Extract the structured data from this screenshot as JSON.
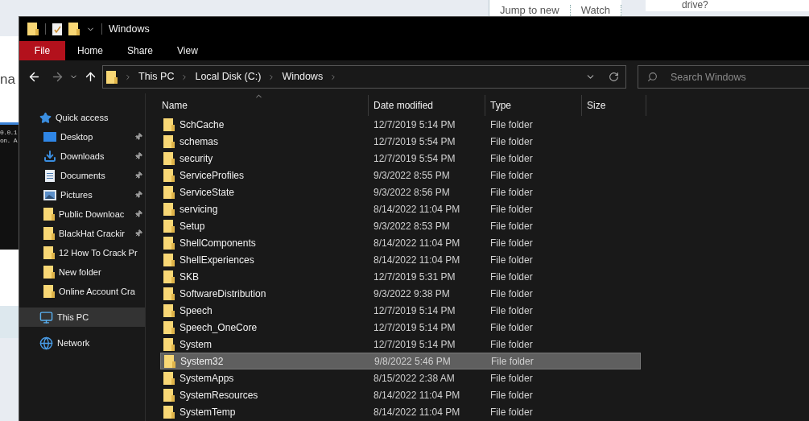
{
  "background": {
    "left_text": "na",
    "terminal_lines": [
      "0.0.1",
      "on. A"
    ],
    "top_links": [
      "Jump to new",
      "Watch"
    ],
    "top_right_text": "drive?"
  },
  "window": {
    "title": "Windows"
  },
  "ribbon_tabs": [
    {
      "label": "File",
      "kind": "file_menu"
    },
    {
      "label": "Home",
      "kind": "tab"
    },
    {
      "label": "Share",
      "kind": "tab"
    },
    {
      "label": "View",
      "kind": "tab"
    }
  ],
  "address": {
    "breadcrumbs": [
      "This PC",
      "Local Disk (C:)",
      "Windows"
    ]
  },
  "search": {
    "placeholder": "Search Windows"
  },
  "sidebar": {
    "items": [
      {
        "label": "Quick access",
        "kind": "quick_access",
        "selected": false,
        "children": [
          {
            "label": "Desktop",
            "kind": "desktop",
            "pinned": true
          },
          {
            "label": "Downloads",
            "kind": "downloads",
            "pinned": true
          },
          {
            "label": "Documents",
            "kind": "documents",
            "pinned": true
          },
          {
            "label": "Pictures",
            "kind": "pictures",
            "pinned": true
          },
          {
            "label": "Public Downloac",
            "kind": "folder",
            "pinned": true
          },
          {
            "label": "BlackHat Crackir",
            "kind": "folder",
            "pinned": true
          },
          {
            "label": "12 How To Crack Pr",
            "kind": "folder",
            "pinned": false
          },
          {
            "label": "New folder",
            "kind": "folder",
            "pinned": false
          },
          {
            "label": "Online Account Cra",
            "kind": "folder",
            "pinned": false
          }
        ]
      },
      {
        "label": "This PC",
        "kind": "pc",
        "selected": true
      },
      {
        "label": "Network",
        "kind": "network",
        "selected": false
      }
    ]
  },
  "table": {
    "columns": [
      {
        "label": "Name",
        "sorted": true
      },
      {
        "label": "Date modified",
        "sorted": false
      },
      {
        "label": "Type",
        "sorted": false
      },
      {
        "label": "Size",
        "sorted": false
      }
    ],
    "rows": [
      {
        "name": "SchCache",
        "date": "12/7/2019 5:14 PM",
        "type": "File folder",
        "selected": false
      },
      {
        "name": "schemas",
        "date": "12/7/2019 5:54 PM",
        "type": "File folder",
        "selected": false
      },
      {
        "name": "security",
        "date": "12/7/2019 5:54 PM",
        "type": "File folder",
        "selected": false
      },
      {
        "name": "ServiceProfiles",
        "date": "9/3/2022 8:55 PM",
        "type": "File folder",
        "selected": false
      },
      {
        "name": "ServiceState",
        "date": "9/3/2022 8:56 PM",
        "type": "File folder",
        "selected": false
      },
      {
        "name": "servicing",
        "date": "8/14/2022 11:04 PM",
        "type": "File folder",
        "selected": false
      },
      {
        "name": "Setup",
        "date": "9/3/2022 8:53 PM",
        "type": "File folder",
        "selected": false
      },
      {
        "name": "ShellComponents",
        "date": "8/14/2022 11:04 PM",
        "type": "File folder",
        "selected": false
      },
      {
        "name": "ShellExperiences",
        "date": "8/14/2022 11:04 PM",
        "type": "File folder",
        "selected": false
      },
      {
        "name": "SKB",
        "date": "12/7/2019 5:31 PM",
        "type": "File folder",
        "selected": false
      },
      {
        "name": "SoftwareDistribution",
        "date": "9/3/2022 9:38 PM",
        "type": "File folder",
        "selected": false
      },
      {
        "name": "Speech",
        "date": "12/7/2019 5:14 PM",
        "type": "File folder",
        "selected": false
      },
      {
        "name": "Speech_OneCore",
        "date": "12/7/2019 5:14 PM",
        "type": "File folder",
        "selected": false
      },
      {
        "name": "System",
        "date": "12/7/2019 5:14 PM",
        "type": "File folder",
        "selected": false
      },
      {
        "name": "System32",
        "date": "9/8/2022 5:46 PM",
        "type": "File folder",
        "selected": true
      },
      {
        "name": "SystemApps",
        "date": "8/15/2022 2:38 AM",
        "type": "File folder",
        "selected": false
      },
      {
        "name": "SystemResources",
        "date": "8/14/2022 11:04 PM",
        "type": "File folder",
        "selected": false
      },
      {
        "name": "SystemTemp",
        "date": "8/14/2022 11:04 PM",
        "type": "File folder",
        "selected": false
      }
    ]
  }
}
